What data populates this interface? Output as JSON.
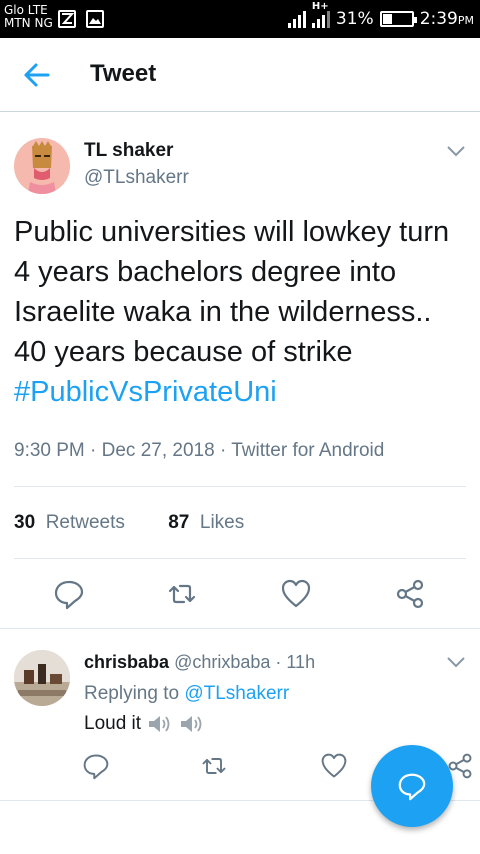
{
  "status_bar": {
    "carrier_line1": "Glo LTE",
    "carrier_line2": "MTN NG",
    "battery_percent": "31%",
    "battery_level": 0.31,
    "time": "2:39",
    "ampm": "PM",
    "network_label": "H+"
  },
  "header": {
    "title": "Tweet"
  },
  "tweet": {
    "name": "TL shaker",
    "handle": "@TLshakerr",
    "text": "Public universities will lowkey turn 4 years bachelors degree into Israelite waka in the wilderness.. 40 years because of strike ",
    "hashtag": "#PublicVsPrivateUni",
    "meta": "9:30 PM · Dec 27, 2018 · Twitter for Android",
    "retweets_count": "30",
    "retweets_label": "Retweets",
    "likes_count": "87",
    "likes_label": "Likes"
  },
  "reply": {
    "name": "chrisbaba",
    "handle_time": "@chrixbaba · 11h",
    "replying_prefix": "Replying to",
    "replying_to": "@TLshakerr",
    "text": "Loud it"
  },
  "colors": {
    "accent": "#1da1f2",
    "secondary_text": "#657786",
    "primary_text": "#14171a",
    "divider": "#e1e8ed"
  }
}
